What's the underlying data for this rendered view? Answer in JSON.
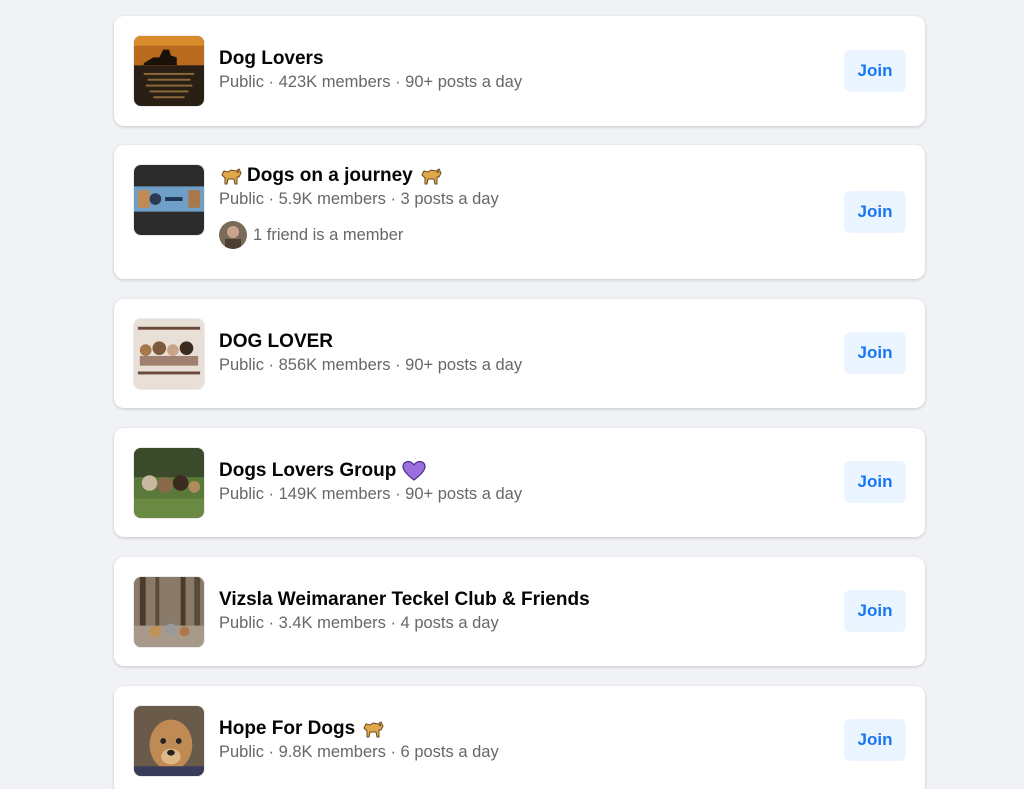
{
  "groups": [
    {
      "name": "Dog Lovers",
      "meta": "Public · 423K members · 90+ posts a day",
      "join_label": "Join"
    },
    {
      "name": "Dogs on a journey",
      "meta": "Public · 5.9K members · 3 posts a day",
      "friend_text": "1 friend is a member",
      "join_label": "Join"
    },
    {
      "name": "DOG LOVER",
      "meta": "Public · 856K members · 90+ posts a day",
      "join_label": "Join"
    },
    {
      "name": "Dogs Lovers Group",
      "meta": "Public · 149K members · 90+ posts a day",
      "join_label": "Join"
    },
    {
      "name": "Vizsla Weimaraner Teckel Club & Friends",
      "meta": "Public · 3.4K members · 4 posts a day",
      "join_label": "Join"
    },
    {
      "name": "Hope For Dogs",
      "meta": "Public · 9.8K members · 6 posts a day",
      "join_label": "Join"
    }
  ],
  "colors": {
    "page_bg": "#f0f2f5",
    "card_bg": "#ffffff",
    "join_bg": "#ebf5ff",
    "join_text": "#1877f2",
    "meta_text": "#65676b"
  }
}
